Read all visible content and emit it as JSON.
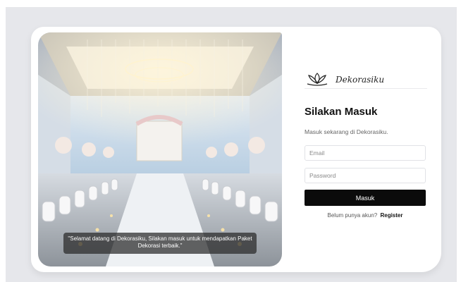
{
  "hero": {
    "caption": "\"Selamat datang di Dekorasiku, Silakan masuk untuk mendapatkan Paket Dekorasi terbaik.\""
  },
  "brand": {
    "name": "Dekorasiku"
  },
  "login": {
    "title": "Silakan Masuk",
    "subtitle": "Masuk sekarang di Dekorasiku.",
    "email_placeholder": "Email",
    "password_placeholder": "Password",
    "submit_label": "Masuk",
    "register_prompt": "Belum punya akun?",
    "register_label": "Register"
  },
  "colors": {
    "page_background": "#e6e7eb",
    "card_background": "#ffffff",
    "button_background": "#0b0b0b",
    "button_text": "#ffffff"
  },
  "icons": {
    "brand_logo": "lotus-logo-icon"
  }
}
